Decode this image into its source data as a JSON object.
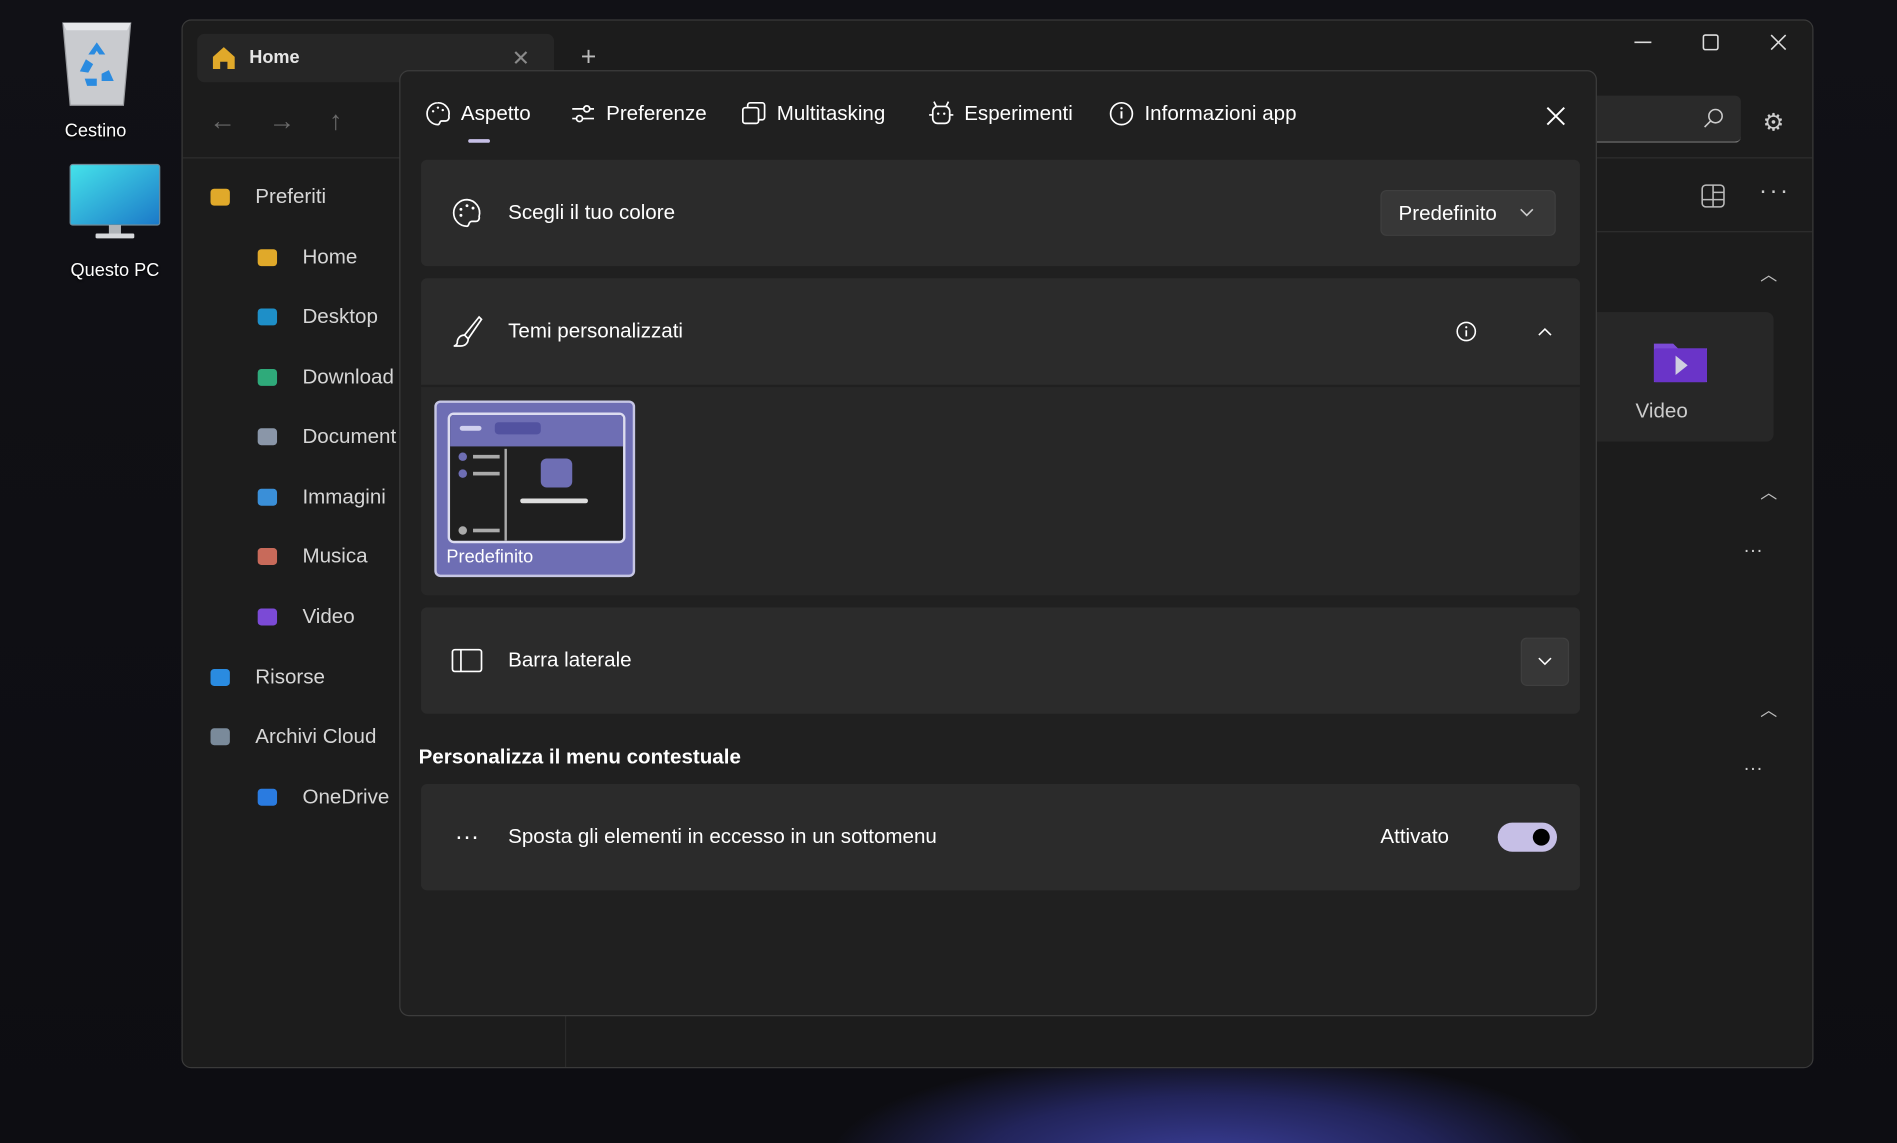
{
  "desktop": {
    "icons": [
      {
        "label": "Cestino",
        "icon": "recycle-bin-icon"
      },
      {
        "label": "Questo PC",
        "icon": "monitor-icon"
      }
    ]
  },
  "explorer": {
    "tab": {
      "label": "Home"
    },
    "sidebar": {
      "items": [
        {
          "label": "Preferiti",
          "icon": "star-icon"
        },
        {
          "label": "Home",
          "icon": "home-icon"
        },
        {
          "label": "Desktop",
          "icon": "desktop-folder-icon"
        },
        {
          "label": "Download",
          "icon": "download-icon"
        },
        {
          "label": "Document",
          "icon": "documents-icon"
        },
        {
          "label": "Immagini",
          "icon": "pictures-icon"
        },
        {
          "label": "Musica",
          "icon": "music-icon"
        },
        {
          "label": "Video",
          "icon": "video-icon"
        },
        {
          "label": "Risorse",
          "icon": "pc-icon"
        },
        {
          "label": "Archivi Cloud",
          "icon": "cloud-drive-icon"
        },
        {
          "label": "OneDrive",
          "icon": "onedrive-icon"
        }
      ]
    },
    "tile": {
      "label": "Video"
    }
  },
  "settings": {
    "tabs": [
      {
        "label": "Aspetto",
        "active": true
      },
      {
        "label": "Preferenze"
      },
      {
        "label": "Multitasking"
      },
      {
        "label": "Esperimenti"
      },
      {
        "label": "Informazioni app"
      }
    ],
    "color": {
      "label": "Scegli il tuo colore",
      "value": "Predefinito"
    },
    "themes": {
      "label": "Temi personalizzati",
      "expanded": true,
      "items": [
        {
          "label": "Predefinito",
          "selected": true
        }
      ]
    },
    "sidebar": {
      "label": "Barra laterale",
      "expanded": false
    },
    "context_section": "Personalizza il menu contestuale",
    "overflow": {
      "label": "Sposta gli elementi in eccesso in un sottomenu",
      "state": "Attivato",
      "on": true
    },
    "accent": "#6e6eb4",
    "toggle_color": "#c6bfe6"
  }
}
